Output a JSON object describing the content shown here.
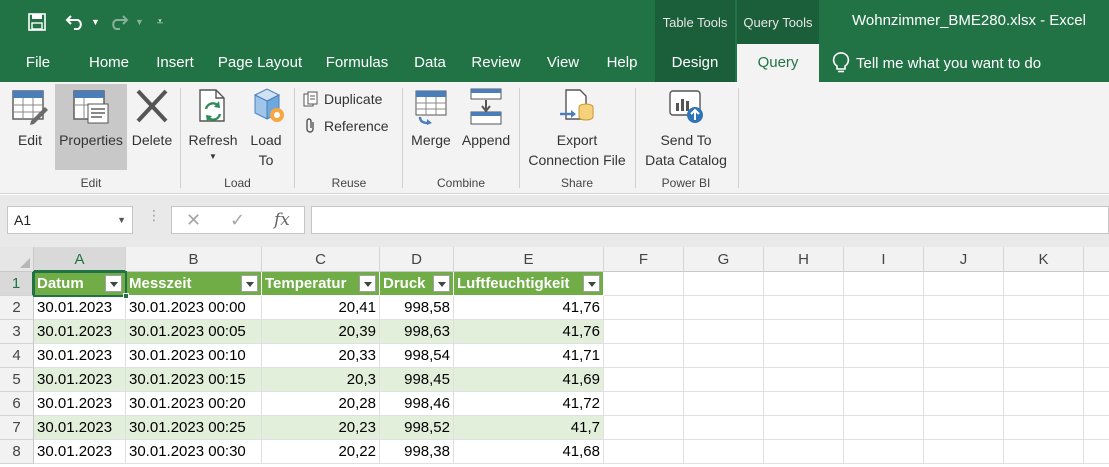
{
  "colors": {
    "brand": "#217346",
    "context_tab": "#1b5e3a",
    "table_header": "#70ad47",
    "table_band": "#e2efda"
  },
  "quick_access": {
    "save_icon": "save-icon",
    "undo_icon": "undo-icon",
    "redo_icon": "redo-icon",
    "customize_icon": "customize-qat-icon"
  },
  "context_headers": {
    "table_tools": "Table Tools",
    "query_tools": "Query Tools"
  },
  "window_title": "Wohnzimmer_BME280.xlsx  -  Excel",
  "tabs": [
    "File",
    "Home",
    "Insert",
    "Page Layout",
    "Formulas",
    "Data",
    "Review",
    "View",
    "Help",
    "Design",
    "Query"
  ],
  "tell_me": "Tell me what you want to do",
  "ribbon": {
    "edit": {
      "edit": "Edit",
      "properties": "Properties",
      "delete": "Delete",
      "label": "Edit"
    },
    "load": {
      "refresh": "Refresh",
      "load_l1": "Load",
      "load_l2": "To",
      "label": "Load"
    },
    "reuse": {
      "duplicate": "Duplicate",
      "reference": "Reference",
      "label": "Reuse"
    },
    "combine": {
      "merge": "Merge",
      "append": "Append",
      "label": "Combine"
    },
    "share": {
      "export_l1": "Export",
      "export_l2": "Connection File",
      "label": "Share"
    },
    "powerbi": {
      "send_l1": "Send To",
      "send_l2": "Data Catalog",
      "label": "Power BI"
    }
  },
  "formula_bar": {
    "name_box": "A1",
    "cancel": "✕",
    "enter": "✓",
    "fx": "fx",
    "value": ""
  },
  "sheet": {
    "columns": [
      "A",
      "B",
      "C",
      "D",
      "E",
      "F",
      "G",
      "H",
      "I",
      "J",
      "K"
    ],
    "rows": [
      "1",
      "2",
      "3",
      "4",
      "5",
      "6",
      "7",
      "8"
    ],
    "headers": [
      "Datum",
      "Messzeit",
      "Temperatur",
      "Druck",
      "Luftfeuchtigkeit"
    ],
    "data": [
      [
        "30.01.2023",
        "30.01.2023 00:00",
        "20,41",
        "998,58",
        "41,76"
      ],
      [
        "30.01.2023",
        "30.01.2023 00:05",
        "20,39",
        "998,63",
        "41,76"
      ],
      [
        "30.01.2023",
        "30.01.2023 00:10",
        "20,33",
        "998,54",
        "41,71"
      ],
      [
        "30.01.2023",
        "30.01.2023 00:15",
        "20,3",
        "998,45",
        "41,69"
      ],
      [
        "30.01.2023",
        "30.01.2023 00:20",
        "20,28",
        "998,46",
        "41,72"
      ],
      [
        "30.01.2023",
        "30.01.2023 00:25",
        "20,23",
        "998,52",
        "41,7"
      ],
      [
        "30.01.2023",
        "30.01.2023 00:30",
        "20,22",
        "998,38",
        "41,68"
      ]
    ]
  }
}
